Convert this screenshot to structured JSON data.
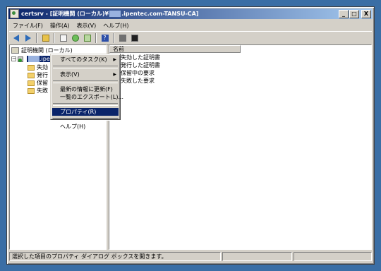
{
  "window": {
    "title_prefix": "certsrv - [証明機関 (ローカル)¥",
    "title_blur": "  ",
    "title_suffix": ".ipentec.com-TANSU-CA]",
    "caption_buttons": [
      "_",
      "□",
      "X"
    ]
  },
  "menubar": [
    "ファイル(F)",
    "操作(A)",
    "表示(V)",
    "ヘルプ(H)"
  ],
  "toolbar": {
    "icons": [
      "back-icon",
      "forward-icon",
      "up-folder-icon",
      "properties-icon",
      "refresh-icon",
      "export-list-icon",
      "help-icon",
      "start-service-icon",
      "stop-service-icon"
    ]
  },
  "tree": {
    "root_label": "証明機関 (ローカル)",
    "ca_prefix": "  ",
    "ca_suffix": ".ipen",
    "children": [
      "失効",
      "発行",
      "保留",
      "失敗"
    ]
  },
  "list": {
    "column_header": "名前",
    "items": [
      "失効した証明書",
      "発行した証明書",
      "保留中の要求",
      "失敗した要求"
    ]
  },
  "context_menu": {
    "items": [
      {
        "label": "すべてのタスク(K)",
        "submenu": "▶"
      },
      {
        "label": "表示(V)",
        "submenu": "▶"
      },
      {
        "label": "最新の情報に更新(F)"
      },
      {
        "label": "一覧のエクスポート(L)..."
      },
      {
        "label": "プロパティ(R)"
      },
      {
        "label": "ヘルプ(H)"
      }
    ]
  },
  "statusbar": {
    "text": "選択した項目のプロパティ ダイアログ ボックスを開きます。"
  },
  "colors": {
    "desktop": "#3a6ea5",
    "title_start": "#0a246a",
    "title_end": "#a6caf0",
    "selection": "#0a246a"
  }
}
